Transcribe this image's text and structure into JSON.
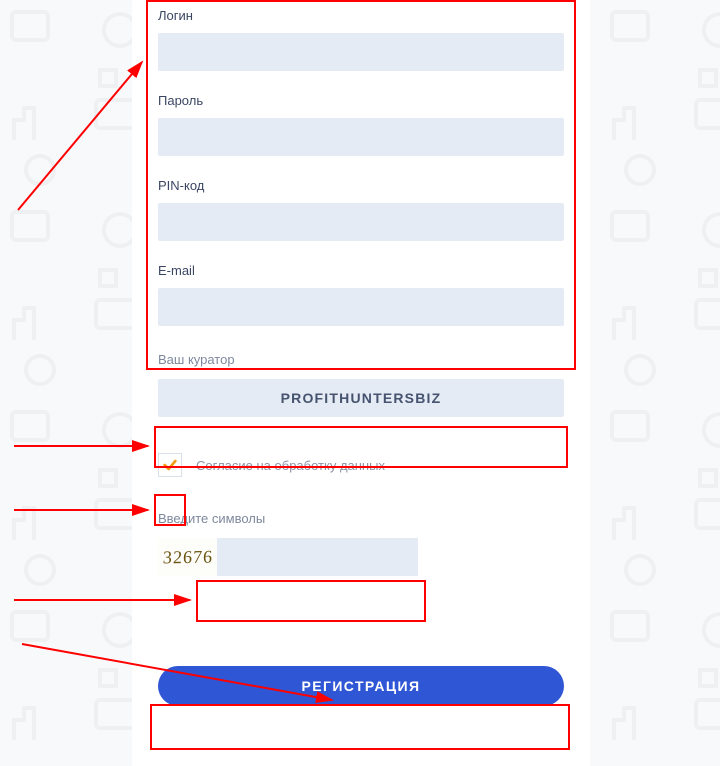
{
  "form": {
    "login_label": "Логин",
    "password_label": "Пароль",
    "pin_label": "PIN-код",
    "email_label": "E-mail",
    "login_value": "",
    "password_value": "",
    "pin_value": "",
    "email_value": ""
  },
  "curator": {
    "label": "Ваш куратор",
    "value": "PROFITHUNTERSBIZ"
  },
  "consent": {
    "checked": true,
    "label": "Согласие на обработку данных"
  },
  "captcha": {
    "label": "Введите символы",
    "code": "32676",
    "input_value": ""
  },
  "submit": {
    "label": "РЕГИСТРАЦИЯ"
  }
}
